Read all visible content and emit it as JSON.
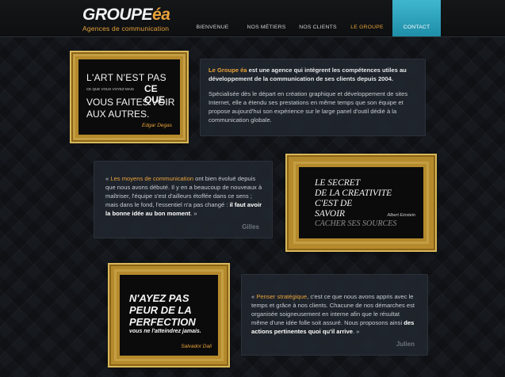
{
  "logo": {
    "main_prefix": "GROUPE",
    "main_accent": "éa",
    "subtitle": "Agences de communication"
  },
  "nav": {
    "items": [
      {
        "label": "BIENVENUE"
      },
      {
        "label": "NOS MÉTIERS"
      },
      {
        "label": "NOS CLIENTS"
      },
      {
        "label": "LE GROUPE"
      },
      {
        "label": "CONTACT"
      }
    ]
  },
  "quote1": {
    "line1": "L'ART N'EST PAS",
    "small": "CE QUE VOUS VOYEZ MAIS",
    "emph": "CE QUE",
    "line3": "VOUS FAITES VOIR",
    "line4": "AUX AUTRES.",
    "author": "Edgar Degas"
  },
  "intro": {
    "p1_highlight": "Le Groupe éa",
    "p1_rest": " est une agence qui intègrent les compétences utiles au développement de la communication de ses clients depuis 2004.",
    "p2": "Spécialisée dès le départ en création graphique et développement de sites Internet, elle a étendu ses prestations en même temps que son équipe et propose aujourd'hui son expérience sur le large panel d'outil dédié à la communication globale."
  },
  "testimonial1": {
    "open": "« ",
    "highlight": "Les moyens de communication",
    "text": " ont bien évolué depuis que nous avons débuté. Il y en a beaucoup de nouveaux à maîtriser, l'équipe s'est d'ailleurs étoffée dans ce sens ; mais dans le fond, l'essentiel n'a pas changé : ",
    "bold": "il faut avoir la bonne idée au bon moment",
    "close": ". »",
    "signature": "Gilles"
  },
  "quote2": {
    "line1": "LE SECRET",
    "line2": "DE LA CREATIVITE",
    "line3": "C'EST DE",
    "line4": "SAVOIR",
    "line5": "CACHER SES SOURCES",
    "author": "Albert Einstein"
  },
  "quote3": {
    "line1": "N'AYEZ PAS",
    "line2": "PEUR DE LA",
    "line3": "PERFECTION",
    "line4": "vous ne l'atteindrez jamais.",
    "author": "Salvador Dali"
  },
  "testimonial2": {
    "open": "« ",
    "highlight": "Penser stratégique",
    "text": ", c'est ce que nous avons appris avec le temps et grâce à nos clients. Chacune de nos démarches est organisée soigneusement en interne afin que le résultat même d'une idée folle soit assuré. Nous proposons ainsi ",
    "bold": "des actions pertinentes quoi qu'il arrive",
    "close": ". »",
    "signature": "Julien"
  },
  "colors": {
    "accent": "#e8a23a",
    "contact_bg": "#2aa2bd",
    "frame_gold": "#b58a2c"
  }
}
